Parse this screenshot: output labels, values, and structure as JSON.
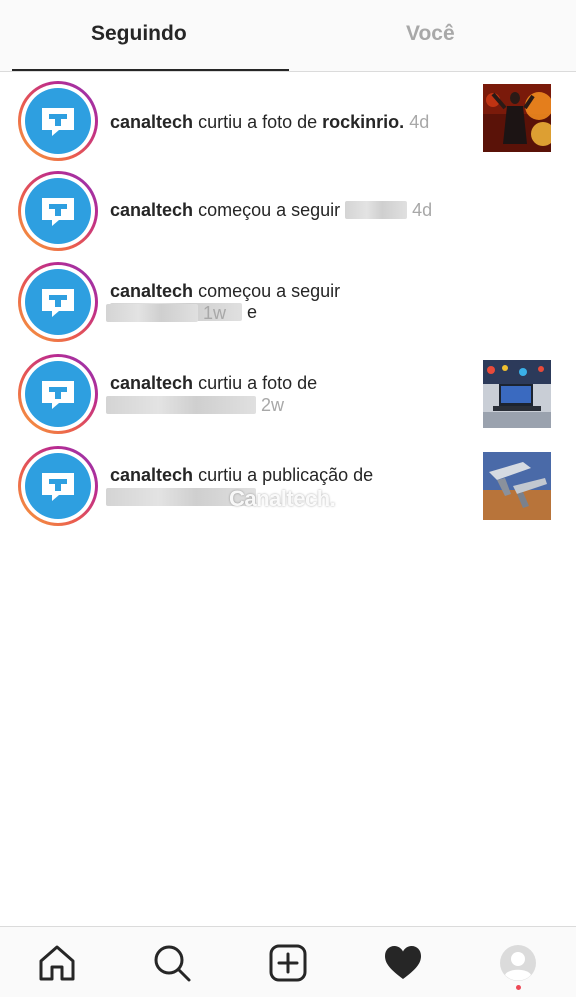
{
  "tabs": {
    "following": "Seguindo",
    "you": "Você"
  },
  "notifications": [
    {
      "user": "canaltech",
      "action": "curtiu a foto de",
      "target": "rockinrio.",
      "time": "4d"
    },
    {
      "user": "canaltech",
      "action": "começou a seguir",
      "target": "",
      "time": "4d"
    },
    {
      "user": "canaltech",
      "action": "começou a seguir",
      "target": "",
      "conjunction": "e",
      "time": "1w"
    },
    {
      "user": "canaltech",
      "action": "curtiu a foto de",
      "target": "",
      "time": "2w"
    },
    {
      "user": "canaltech",
      "action": "curtiu a publicação de",
      "target": "",
      "time": ""
    }
  ],
  "watermark": "Canaltech.",
  "nav": {
    "items": [
      "home-icon",
      "search-icon",
      "new-post-icon",
      "activity-heart-icon",
      "profile-avatar-icon"
    ],
    "dot_color": "#ed4956"
  },
  "colors": {
    "accent_blue": "#2e9fe0",
    "ring_gradient": [
      "#f7a23b",
      "#e95950",
      "#bc2a8d",
      "#8a3ab9"
    ],
    "muted": "#a8a8a8"
  }
}
